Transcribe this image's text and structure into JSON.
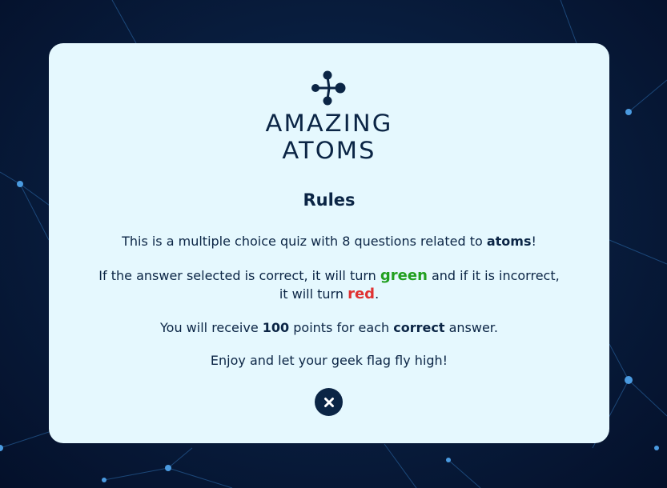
{
  "logo": {
    "line1": "AMAZING",
    "line2": "ATOMS"
  },
  "rules": {
    "title": "Rules",
    "p1_text": "This is a multiple choice quiz with 8 questions related to ",
    "p1_bold": "atoms",
    "p1_end": "!",
    "p2_text_a": "If the answer selected is correct, it will turn ",
    "p2_green": "green",
    "p2_text_b": " and if it is incorrect, it will turn ",
    "p2_red": "red",
    "p2_end": ".",
    "p3_text_a": "You will receive ",
    "p3_bold_points": "100",
    "p3_text_b": " points for each ",
    "p3_bold_correct": "correct",
    "p3_text_c": " answer.",
    "p4_text": "Enjoy and let your geek flag fly high!"
  },
  "close_button": {
    "icon": "close-icon"
  },
  "colors": {
    "modal_bg": "#e5f8fe",
    "text": "#0b2545",
    "green": "#22a020",
    "red": "#e03232",
    "background": "#081c3c"
  }
}
